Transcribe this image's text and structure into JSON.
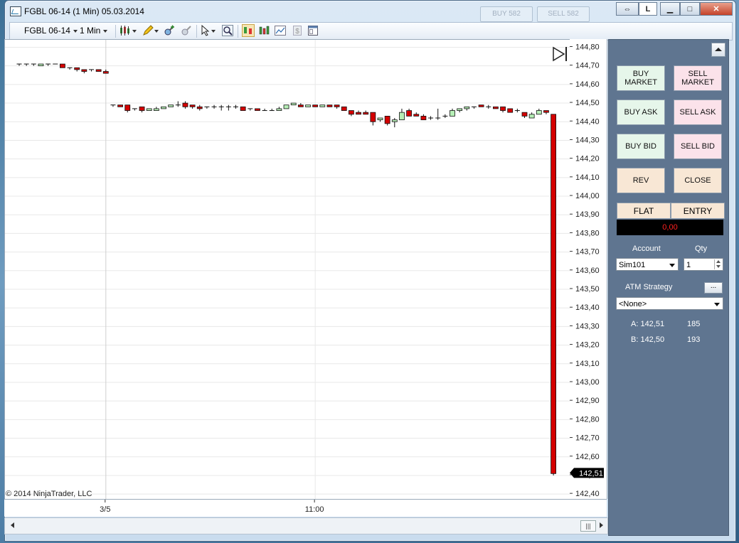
{
  "window": {
    "title": "FGBL 06-14 (1 Min)  05.03.2014"
  },
  "caption": {
    "link_label": "L",
    "ghost_buttons": [
      "BUY 582",
      "SELL 582"
    ]
  },
  "toolbar": {
    "instrument": "FGBL 06-14",
    "interval": "1 Min"
  },
  "chart_data": {
    "type": "candlestick",
    "y_ticks": [
      "144,80",
      "144,70",
      "144,60",
      "144,50",
      "144,40",
      "144,30",
      "144,20",
      "144,10",
      "144,00",
      "143,90",
      "143,80",
      "143,70",
      "143,60",
      "143,50",
      "143,40",
      "143,30",
      "143,20",
      "143,10",
      "143,00",
      "142,90",
      "142,80",
      "142,70",
      "142,60",
      "142,50",
      "142,40"
    ],
    "ylim": [
      142.37,
      144.84
    ],
    "x_labels": [
      {
        "label": "3/5",
        "bar_index": 12
      },
      {
        "label": "11:00",
        "bar_index": 41
      }
    ],
    "last_price_label": "142,51",
    "last_price": 142.51,
    "grid": true,
    "candles": [
      {
        "o": 144.71,
        "h": 144.71,
        "l": 144.7,
        "c": 144.71
      },
      {
        "o": 144.71,
        "h": 144.71,
        "l": 144.7,
        "c": 144.71
      },
      {
        "o": 144.71,
        "h": 144.71,
        "l": 144.7,
        "c": 144.71
      },
      {
        "o": 144.7,
        "h": 144.71,
        "l": 144.7,
        "c": 144.71
      },
      {
        "o": 144.71,
        "h": 144.71,
        "l": 144.7,
        "c": 144.71
      },
      {
        "o": 144.71,
        "h": 144.71,
        "l": 144.71,
        "c": 144.71
      },
      {
        "o": 144.71,
        "h": 144.71,
        "l": 144.69,
        "c": 144.69
      },
      {
        "o": 144.69,
        "h": 144.69,
        "l": 144.68,
        "c": 144.69
      },
      {
        "o": 144.69,
        "h": 144.69,
        "l": 144.67,
        "c": 144.68
      },
      {
        "o": 144.68,
        "h": 144.68,
        "l": 144.66,
        "c": 144.67
      },
      {
        "o": 144.68,
        "h": 144.68,
        "l": 144.67,
        "c": 144.68
      },
      {
        "o": 144.68,
        "h": 144.68,
        "l": 144.67,
        "c": 144.67
      },
      {
        "o": 144.67,
        "h": 144.68,
        "l": 144.66,
        "c": 144.66
      },
      {
        "o": 144.49,
        "h": 144.49,
        "l": 144.48,
        "c": 144.49
      },
      {
        "o": 144.49,
        "h": 144.49,
        "l": 144.48,
        "c": 144.48
      },
      {
        "o": 144.49,
        "h": 144.49,
        "l": 144.45,
        "c": 144.46
      },
      {
        "o": 144.47,
        "h": 144.47,
        "l": 144.46,
        "c": 144.47
      },
      {
        "o": 144.48,
        "h": 144.48,
        "l": 144.45,
        "c": 144.46
      },
      {
        "o": 144.46,
        "h": 144.47,
        "l": 144.46,
        "c": 144.47
      },
      {
        "o": 144.46,
        "h": 144.48,
        "l": 144.46,
        "c": 144.47
      },
      {
        "o": 144.47,
        "h": 144.48,
        "l": 144.47,
        "c": 144.48
      },
      {
        "o": 144.48,
        "h": 144.49,
        "l": 144.48,
        "c": 144.49
      },
      {
        "o": 144.49,
        "h": 144.51,
        "l": 144.48,
        "c": 144.49
      },
      {
        "o": 144.5,
        "h": 144.51,
        "l": 144.47,
        "c": 144.48
      },
      {
        "o": 144.49,
        "h": 144.49,
        "l": 144.47,
        "c": 144.48
      },
      {
        "o": 144.48,
        "h": 144.49,
        "l": 144.46,
        "c": 144.47
      },
      {
        "o": 144.48,
        "h": 144.48,
        "l": 144.47,
        "c": 144.48
      },
      {
        "o": 144.48,
        "h": 144.49,
        "l": 144.47,
        "c": 144.48
      },
      {
        "o": 144.48,
        "h": 144.49,
        "l": 144.46,
        "c": 144.48
      },
      {
        "o": 144.48,
        "h": 144.49,
        "l": 144.46,
        "c": 144.48
      },
      {
        "o": 144.48,
        "h": 144.49,
        "l": 144.47,
        "c": 144.48
      },
      {
        "o": 144.48,
        "h": 144.48,
        "l": 144.46,
        "c": 144.46
      },
      {
        "o": 144.47,
        "h": 144.47,
        "l": 144.46,
        "c": 144.47
      },
      {
        "o": 144.47,
        "h": 144.47,
        "l": 144.46,
        "c": 144.46
      },
      {
        "o": 144.46,
        "h": 144.47,
        "l": 144.46,
        "c": 144.46
      },
      {
        "o": 144.46,
        "h": 144.47,
        "l": 144.46,
        "c": 144.46
      },
      {
        "o": 144.46,
        "h": 144.48,
        "l": 144.46,
        "c": 144.47
      },
      {
        "o": 144.47,
        "h": 144.49,
        "l": 144.47,
        "c": 144.49
      },
      {
        "o": 144.49,
        "h": 144.5,
        "l": 144.49,
        "c": 144.5
      },
      {
        "o": 144.49,
        "h": 144.5,
        "l": 144.48,
        "c": 144.48
      },
      {
        "o": 144.48,
        "h": 144.49,
        "l": 144.48,
        "c": 144.49
      },
      {
        "o": 144.49,
        "h": 144.49,
        "l": 144.48,
        "c": 144.48
      },
      {
        "o": 144.48,
        "h": 144.49,
        "l": 144.48,
        "c": 144.49
      },
      {
        "o": 144.49,
        "h": 144.49,
        "l": 144.48,
        "c": 144.48
      },
      {
        "o": 144.49,
        "h": 144.49,
        "l": 144.47,
        "c": 144.48
      },
      {
        "o": 144.48,
        "h": 144.48,
        "l": 144.46,
        "c": 144.46
      },
      {
        "o": 144.46,
        "h": 144.46,
        "l": 144.43,
        "c": 144.44
      },
      {
        "o": 144.45,
        "h": 144.46,
        "l": 144.44,
        "c": 144.44
      },
      {
        "o": 144.45,
        "h": 144.46,
        "l": 144.44,
        "c": 144.44
      },
      {
        "o": 144.45,
        "h": 144.45,
        "l": 144.38,
        "c": 144.4
      },
      {
        "o": 144.41,
        "h": 144.42,
        "l": 144.4,
        "c": 144.42
      },
      {
        "o": 144.43,
        "h": 144.43,
        "l": 144.38,
        "c": 144.39
      },
      {
        "o": 144.4,
        "h": 144.42,
        "l": 144.37,
        "c": 144.41
      },
      {
        "o": 144.41,
        "h": 144.47,
        "l": 144.41,
        "c": 144.45
      },
      {
        "o": 144.46,
        "h": 144.47,
        "l": 144.43,
        "c": 144.43
      },
      {
        "o": 144.44,
        "h": 144.45,
        "l": 144.43,
        "c": 144.43
      },
      {
        "o": 144.43,
        "h": 144.44,
        "l": 144.41,
        "c": 144.41
      },
      {
        "o": 144.42,
        "h": 144.43,
        "l": 144.41,
        "c": 144.42
      },
      {
        "o": 144.42,
        "h": 144.47,
        "l": 144.41,
        "c": 144.42
      },
      {
        "o": 144.43,
        "h": 144.44,
        "l": 144.42,
        "c": 144.43
      },
      {
        "o": 144.43,
        "h": 144.47,
        "l": 144.43,
        "c": 144.46
      },
      {
        "o": 144.46,
        "h": 144.47,
        "l": 144.45,
        "c": 144.47
      },
      {
        "o": 144.47,
        "h": 144.48,
        "l": 144.46,
        "c": 144.48
      },
      {
        "o": 144.48,
        "h": 144.48,
        "l": 144.47,
        "c": 144.48
      },
      {
        "o": 144.49,
        "h": 144.49,
        "l": 144.48,
        "c": 144.48
      },
      {
        "o": 144.48,
        "h": 144.49,
        "l": 144.47,
        "c": 144.48
      },
      {
        "o": 144.48,
        "h": 144.48,
        "l": 144.47,
        "c": 144.47
      },
      {
        "o": 144.48,
        "h": 144.48,
        "l": 144.45,
        "c": 144.46
      },
      {
        "o": 144.47,
        "h": 144.47,
        "l": 144.45,
        "c": 144.45
      },
      {
        "o": 144.46,
        "h": 144.47,
        "l": 144.45,
        "c": 144.46
      },
      {
        "o": 144.45,
        "h": 144.45,
        "l": 144.42,
        "c": 144.43
      },
      {
        "o": 144.42,
        "h": 144.45,
        "l": 144.42,
        "c": 144.44
      },
      {
        "o": 144.44,
        "h": 144.47,
        "l": 144.44,
        "c": 144.46
      },
      {
        "o": 144.46,
        "h": 144.46,
        "l": 144.44,
        "c": 144.45
      },
      {
        "o": 144.44,
        "h": 144.44,
        "l": 142.5,
        "c": 142.51
      }
    ]
  },
  "copyright": "© 2014 NinjaTrader, LLC",
  "panel": {
    "buy_market": "BUY MARKET",
    "sell_market": "SELL MARKET",
    "buy_ask": "BUY ASK",
    "sell_ask": "SELL ASK",
    "buy_bid": "BUY BID",
    "sell_bid": "SELL BID",
    "rev": "REV",
    "close": "CLOSE",
    "flat": "FLAT",
    "entry": "ENTRY",
    "pnl": "0,00",
    "account_label": "Account",
    "qty_label": "Qty",
    "account_value": "Sim101",
    "qty_value": "1",
    "atm_label": "ATM Strategy",
    "atm_dots": "...",
    "atm_value": "<None>",
    "ask_label": "A: 142,51",
    "ask_size": "185",
    "bid_label": "B: 142,50",
    "bid_size": "193"
  },
  "colors": {
    "up": "#b6efb6",
    "down": "#d40000",
    "grid": "#e8e8e8"
  }
}
